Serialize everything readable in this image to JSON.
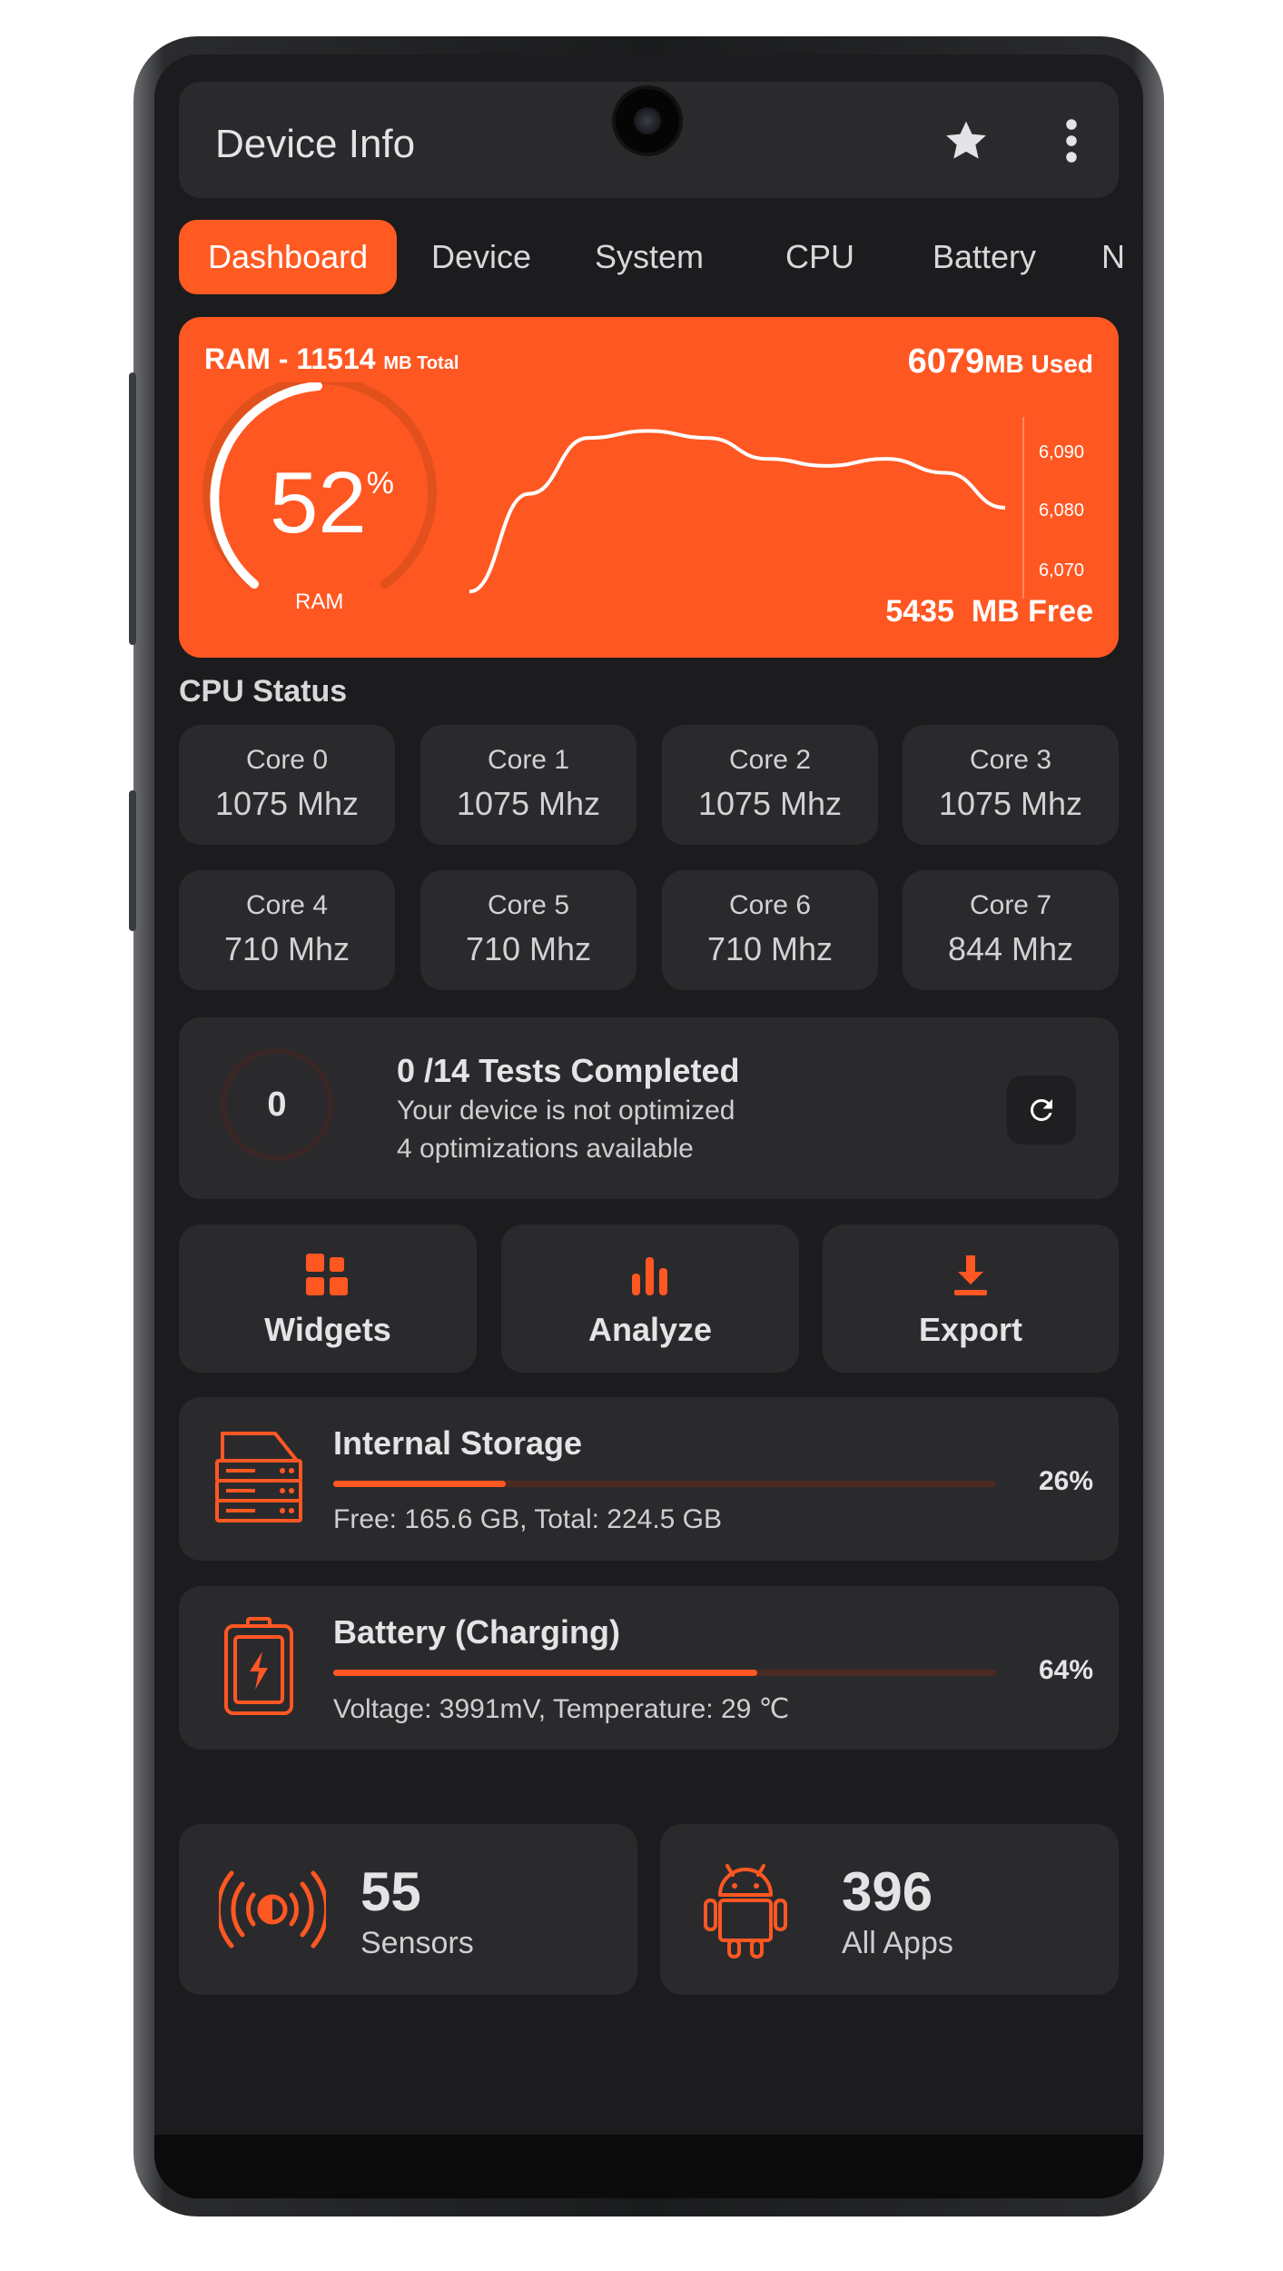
{
  "colors": {
    "accent": "#ff5722",
    "background": "#1c1c1e",
    "card": "#2a2a2d"
  },
  "appbar": {
    "title": "Device Info",
    "icons": [
      "star-icon",
      "more-vert-icon"
    ]
  },
  "tabs": [
    {
      "label": "Dashboard",
      "active": true
    },
    {
      "label": "Device"
    },
    {
      "label": "System"
    },
    {
      "label": "CPU"
    },
    {
      "label": "Battery"
    },
    {
      "label": "N"
    }
  ],
  "ram": {
    "label": "RAM - 11514",
    "total_unit": "MB Total",
    "used_value": "6079",
    "used_unit": "MB Used",
    "free_value": "5435",
    "free_unit": "MB Free",
    "percent": "52",
    "percent_sign": "%",
    "gauge_label": "RAM",
    "axis_ticks": [
      "6,090",
      "6,080",
      "6,070"
    ]
  },
  "chart_data": {
    "type": "line",
    "title": "",
    "ylim": [
      6067,
      6093
    ],
    "series": [
      {
        "values": [
          6068,
          6082,
          6090,
          6091,
          6090,
          6087,
          6086,
          6087,
          6085,
          6080
        ]
      }
    ]
  },
  "cpu": {
    "title": "CPU Status",
    "cores": [
      {
        "name": "Core 0",
        "freq": "1075 Mhz"
      },
      {
        "name": "Core 1",
        "freq": "1075 Mhz"
      },
      {
        "name": "Core 2",
        "freq": "1075 Mhz"
      },
      {
        "name": "Core 3",
        "freq": "1075 Mhz"
      },
      {
        "name": "Core 4",
        "freq": "710 Mhz"
      },
      {
        "name": "Core 5",
        "freq": "710 Mhz"
      },
      {
        "name": "Core 6",
        "freq": "710 Mhz"
      },
      {
        "name": "Core 7",
        "freq": "844 Mhz"
      }
    ]
  },
  "tests": {
    "count": "0",
    "heading": "0 /14 Tests Completed",
    "line1": "Your device is not optimized",
    "line2": "4 optimizations available"
  },
  "actions": [
    {
      "label": "Widgets",
      "icon": "widgets-icon"
    },
    {
      "label": "Analyze",
      "icon": "bar-chart-icon"
    },
    {
      "label": "Export",
      "icon": "download-icon"
    }
  ],
  "storage": {
    "title": "Internal Storage",
    "percent": "26%",
    "fill": 0.26,
    "detail": "Free: 165.6 GB,  Total: 224.5 GB"
  },
  "battery": {
    "title": "Battery (Charging)",
    "percent": "64%",
    "fill": 0.64,
    "detail": "Voltage: 3991mV,  Temperature: 29 ℃"
  },
  "sensors": {
    "count": "55",
    "label": "Sensors"
  },
  "apps": {
    "count": "396",
    "label": "All Apps"
  }
}
